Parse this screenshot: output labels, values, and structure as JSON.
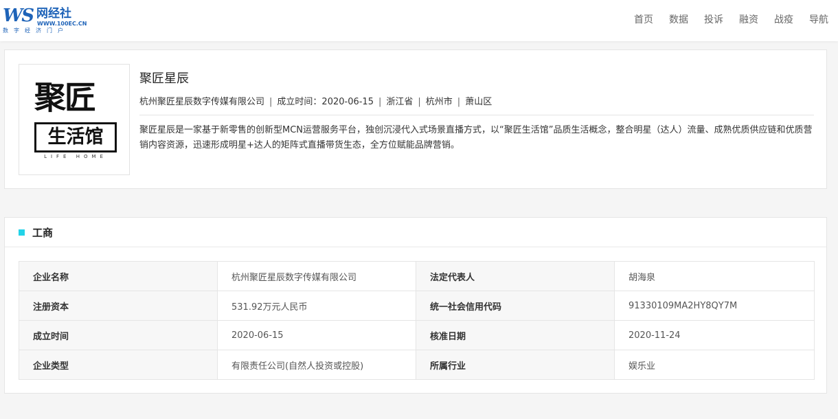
{
  "header": {
    "logo": {
      "mark": "WS",
      "name": "网经社",
      "url": "WWW.100EC.CN",
      "slogan": "数字经济门户"
    },
    "nav": [
      "首页",
      "数据",
      "投诉",
      "融资",
      "战疫",
      "导航"
    ]
  },
  "company": {
    "logo_text": {
      "big": "聚匠",
      "box": "生活馆",
      "small": "LIFE HOME"
    },
    "name": "聚匠星辰",
    "full_name": "杭州聚匠星辰数字传媒有限公司",
    "founded_label": "成立时间：",
    "founded": "2020-06-15",
    "province": "浙江省",
    "city": "杭州市",
    "district": "萧山区",
    "separator": "|",
    "description": "聚匠星辰是一家基于新零售的创新型MCN运营服务平台，独创沉浸代入式场景直播方式，以“聚匠生活馆”品质生活概念，整合明星（达人）流量、成熟优质供应链和优质营销内容资源，迅速形成明星+达人的矩阵式直播带货生态，全方位赋能品牌营销。"
  },
  "business": {
    "title": "工商",
    "rows": [
      {
        "l1": "企业名称",
        "v1": "杭州聚匠星辰数字传媒有限公司",
        "l2": "法定代表人",
        "v2": "胡海泉"
      },
      {
        "l1": "注册资本",
        "v1": "531.92万元人民币",
        "l2": "统一社会信用代码",
        "v2": "91330109MA2HY8QY7M"
      },
      {
        "l1": "成立时间",
        "v1": "2020-06-15",
        "l2": "核准日期",
        "v2": "2020-11-24"
      },
      {
        "l1": "企业类型",
        "v1": "有限责任公司(自然人投资或控股)",
        "l2": "所属行业",
        "v2": "娱乐业"
      }
    ]
  },
  "colors": {
    "brand_blue": "#1e63b8",
    "section_marker": "#22d3e8"
  }
}
